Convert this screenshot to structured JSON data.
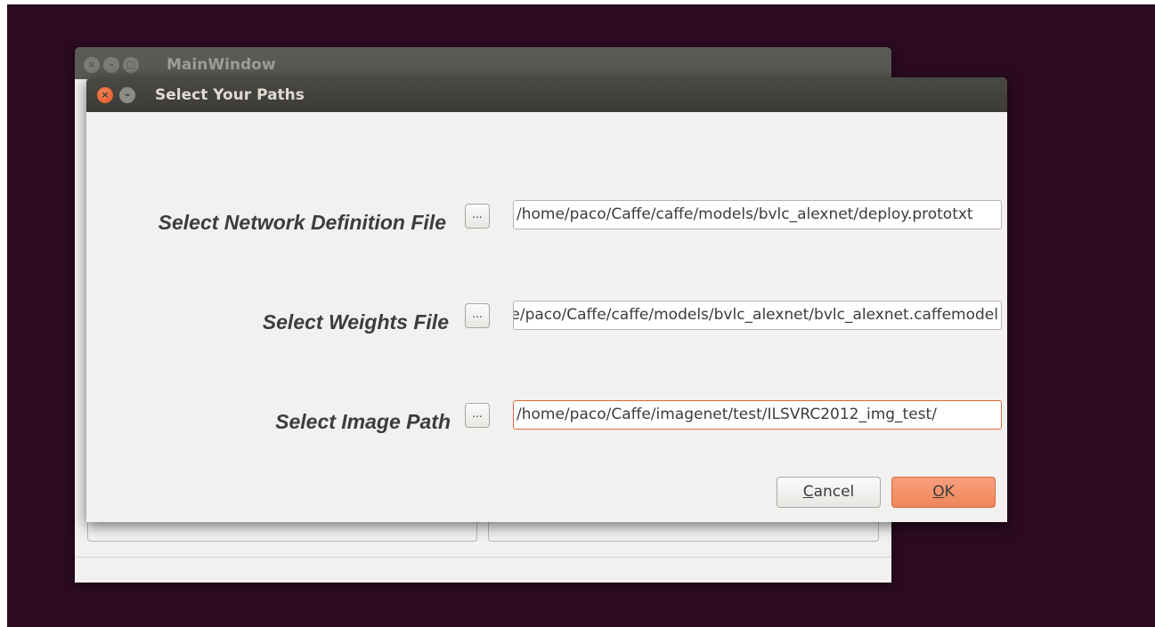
{
  "main_window": {
    "title": "MainWindow",
    "buttons": {
      "close": "×",
      "minimize": "–",
      "maximize": "□"
    }
  },
  "dialog": {
    "title": "Select Your Paths",
    "buttons": {
      "close": "×",
      "minimize": "–"
    },
    "rows": [
      {
        "label": "Select Network Definition File",
        "browse_label": "...",
        "path": "/home/paco/Caffe/caffe/models/bvlc_alexnet/deploy.prototxt"
      },
      {
        "label": "Select Weights File",
        "browse_label": "...",
        "path": "/home/paco/Caffe/caffe/models/bvlc_alexnet/bvlc_alexnet.caffemodel"
      },
      {
        "label": "Select Image Path",
        "browse_label": "...",
        "path": "/home/paco/Caffe/imagenet/test/ILSVRC2012_img_test/"
      }
    ],
    "cancel_label": "Cancel",
    "ok_label": "OK"
  },
  "colors": {
    "desktop": "#2c0b22",
    "titlebar": "#3c3b37",
    "accent": "#ef8659",
    "focus_border": "#e06a3a"
  }
}
